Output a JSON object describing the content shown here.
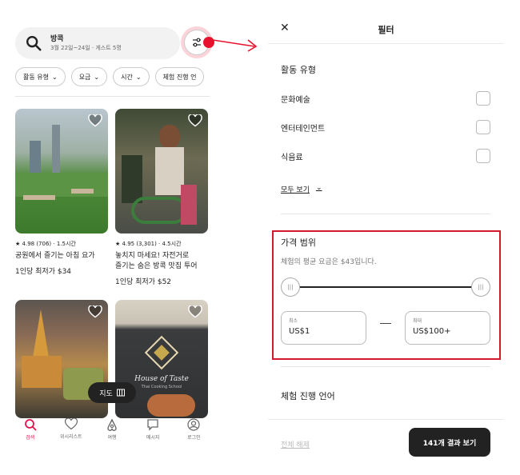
{
  "search": {
    "location": "방콕",
    "details": "3월 22일~24일 · 게스트 5명"
  },
  "chips": [
    {
      "label": "활동 유형"
    },
    {
      "label": "요금"
    },
    {
      "label": "시간"
    },
    {
      "label": "체험 진행 언"
    }
  ],
  "cards": [
    {
      "meta": "4.98 (706) · 1.5시간",
      "title_line1": "공원에서 즐기는 아침 요가",
      "title_line2": "",
      "price": "1인당 최저가 $34"
    },
    {
      "meta": "4.95 (3,301) · 4.5시간",
      "title_line1": "놓치지 마세요! 자전거로",
      "title_line2": "즐기는 숨은 방콕 맛집 투어",
      "price": "1인당 최저가 $52"
    },
    {
      "meta": "",
      "title_line1": "",
      "title_line2": "",
      "price": ""
    },
    {
      "meta": "",
      "title_line1": "",
      "title_line2": "",
      "price": "",
      "apron_text": "House of Taste",
      "apron_sub": "Thai Cooking School"
    }
  ],
  "map_button": "지도",
  "nav": [
    {
      "label": "검색",
      "icon": "search-icon"
    },
    {
      "label": "위시리스트",
      "icon": "heart-icon"
    },
    {
      "label": "여행",
      "icon": "airbnb-logo-icon"
    },
    {
      "label": "메시지",
      "icon": "message-icon"
    },
    {
      "label": "로그인",
      "icon": "user-icon"
    }
  ],
  "filter": {
    "title": "필터",
    "activity_title": "활동 유형",
    "options": [
      {
        "label": "문화예술"
      },
      {
        "label": "엔터테인먼트"
      },
      {
        "label": "식음료"
      }
    ],
    "show_more": "모두 보기",
    "price_title": "가격 범위",
    "price_avg": "체험의 평균 요금은 $43입니다.",
    "min_label": "최소",
    "min_value": "US$1",
    "max_label": "최대",
    "max_value": "US$100+",
    "language_title": "체험 진행 언어",
    "clear_label": "전체 해제",
    "show_results": "141개 결과 보기"
  },
  "colors": {
    "accent": "#e8114d",
    "highlight": "#d31a2e",
    "dark_button": "#222222"
  }
}
